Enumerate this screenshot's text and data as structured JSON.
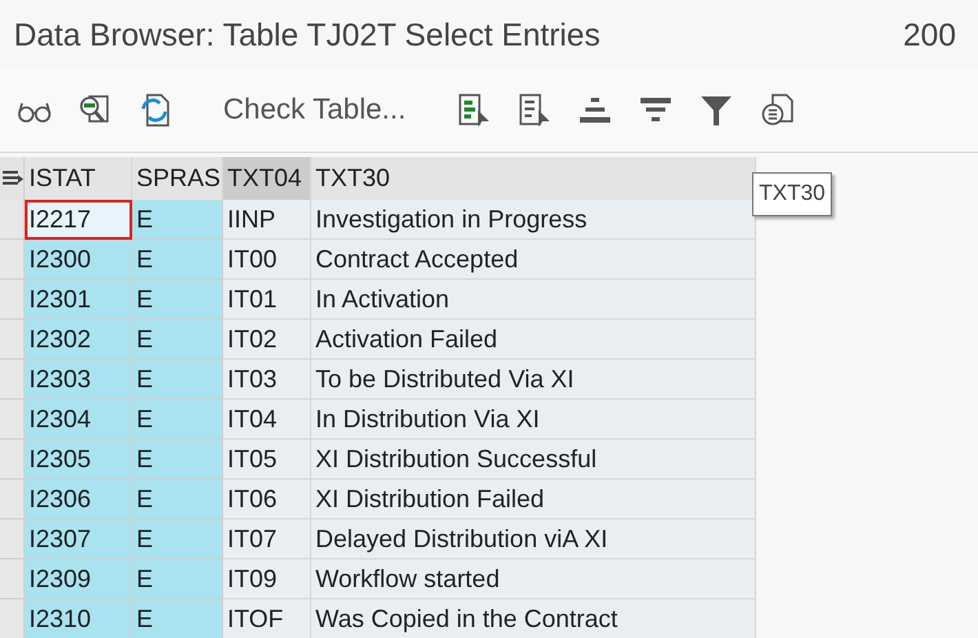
{
  "window": {
    "title": "Data Browser: Table TJ02T Select Entries",
    "client": "200"
  },
  "toolbar": {
    "text_button": "Check Table..."
  },
  "table": {
    "columns": [
      {
        "label": "ISTAT",
        "key": true,
        "selected": false
      },
      {
        "label": "SPRAS",
        "key": true,
        "selected": false
      },
      {
        "label": "TXT04",
        "key": false,
        "selected": true
      },
      {
        "label": "TXT30",
        "key": false,
        "selected": false
      }
    ],
    "rows": [
      {
        "cells": [
          "I2217",
          "E",
          "IINP",
          "Investigation in Progress"
        ],
        "focused": true
      },
      {
        "cells": [
          "I2300",
          "E",
          "IT00",
          "Contract Accepted"
        ],
        "focused": false
      },
      {
        "cells": [
          "I2301",
          "E",
          "IT01",
          "In Activation"
        ],
        "focused": false
      },
      {
        "cells": [
          "I2302",
          "E",
          "IT02",
          "Activation Failed"
        ],
        "focused": false
      },
      {
        "cells": [
          "I2303",
          "E",
          "IT03",
          "To be Distributed Via XI"
        ],
        "focused": false
      },
      {
        "cells": [
          "I2304",
          "E",
          "IT04",
          "In Distribution Via XI"
        ],
        "focused": false
      },
      {
        "cells": [
          "I2305",
          "E",
          "IT05",
          "XI Distribution Successful"
        ],
        "focused": false
      },
      {
        "cells": [
          "I2306",
          "E",
          "IT06",
          "XI Distribution Failed"
        ],
        "focused": false
      },
      {
        "cells": [
          "I2307",
          "E",
          "IT07",
          "Delayed Distribution viA XI"
        ],
        "focused": false
      },
      {
        "cells": [
          "I2309",
          "E",
          "IT09",
          "Workflow started"
        ],
        "focused": false
      },
      {
        "cells": [
          "I2310",
          "E",
          "ITOF",
          "Was Copied in the Contract"
        ],
        "focused": false
      }
    ]
  },
  "tooltip": {
    "text": "TXT30"
  }
}
